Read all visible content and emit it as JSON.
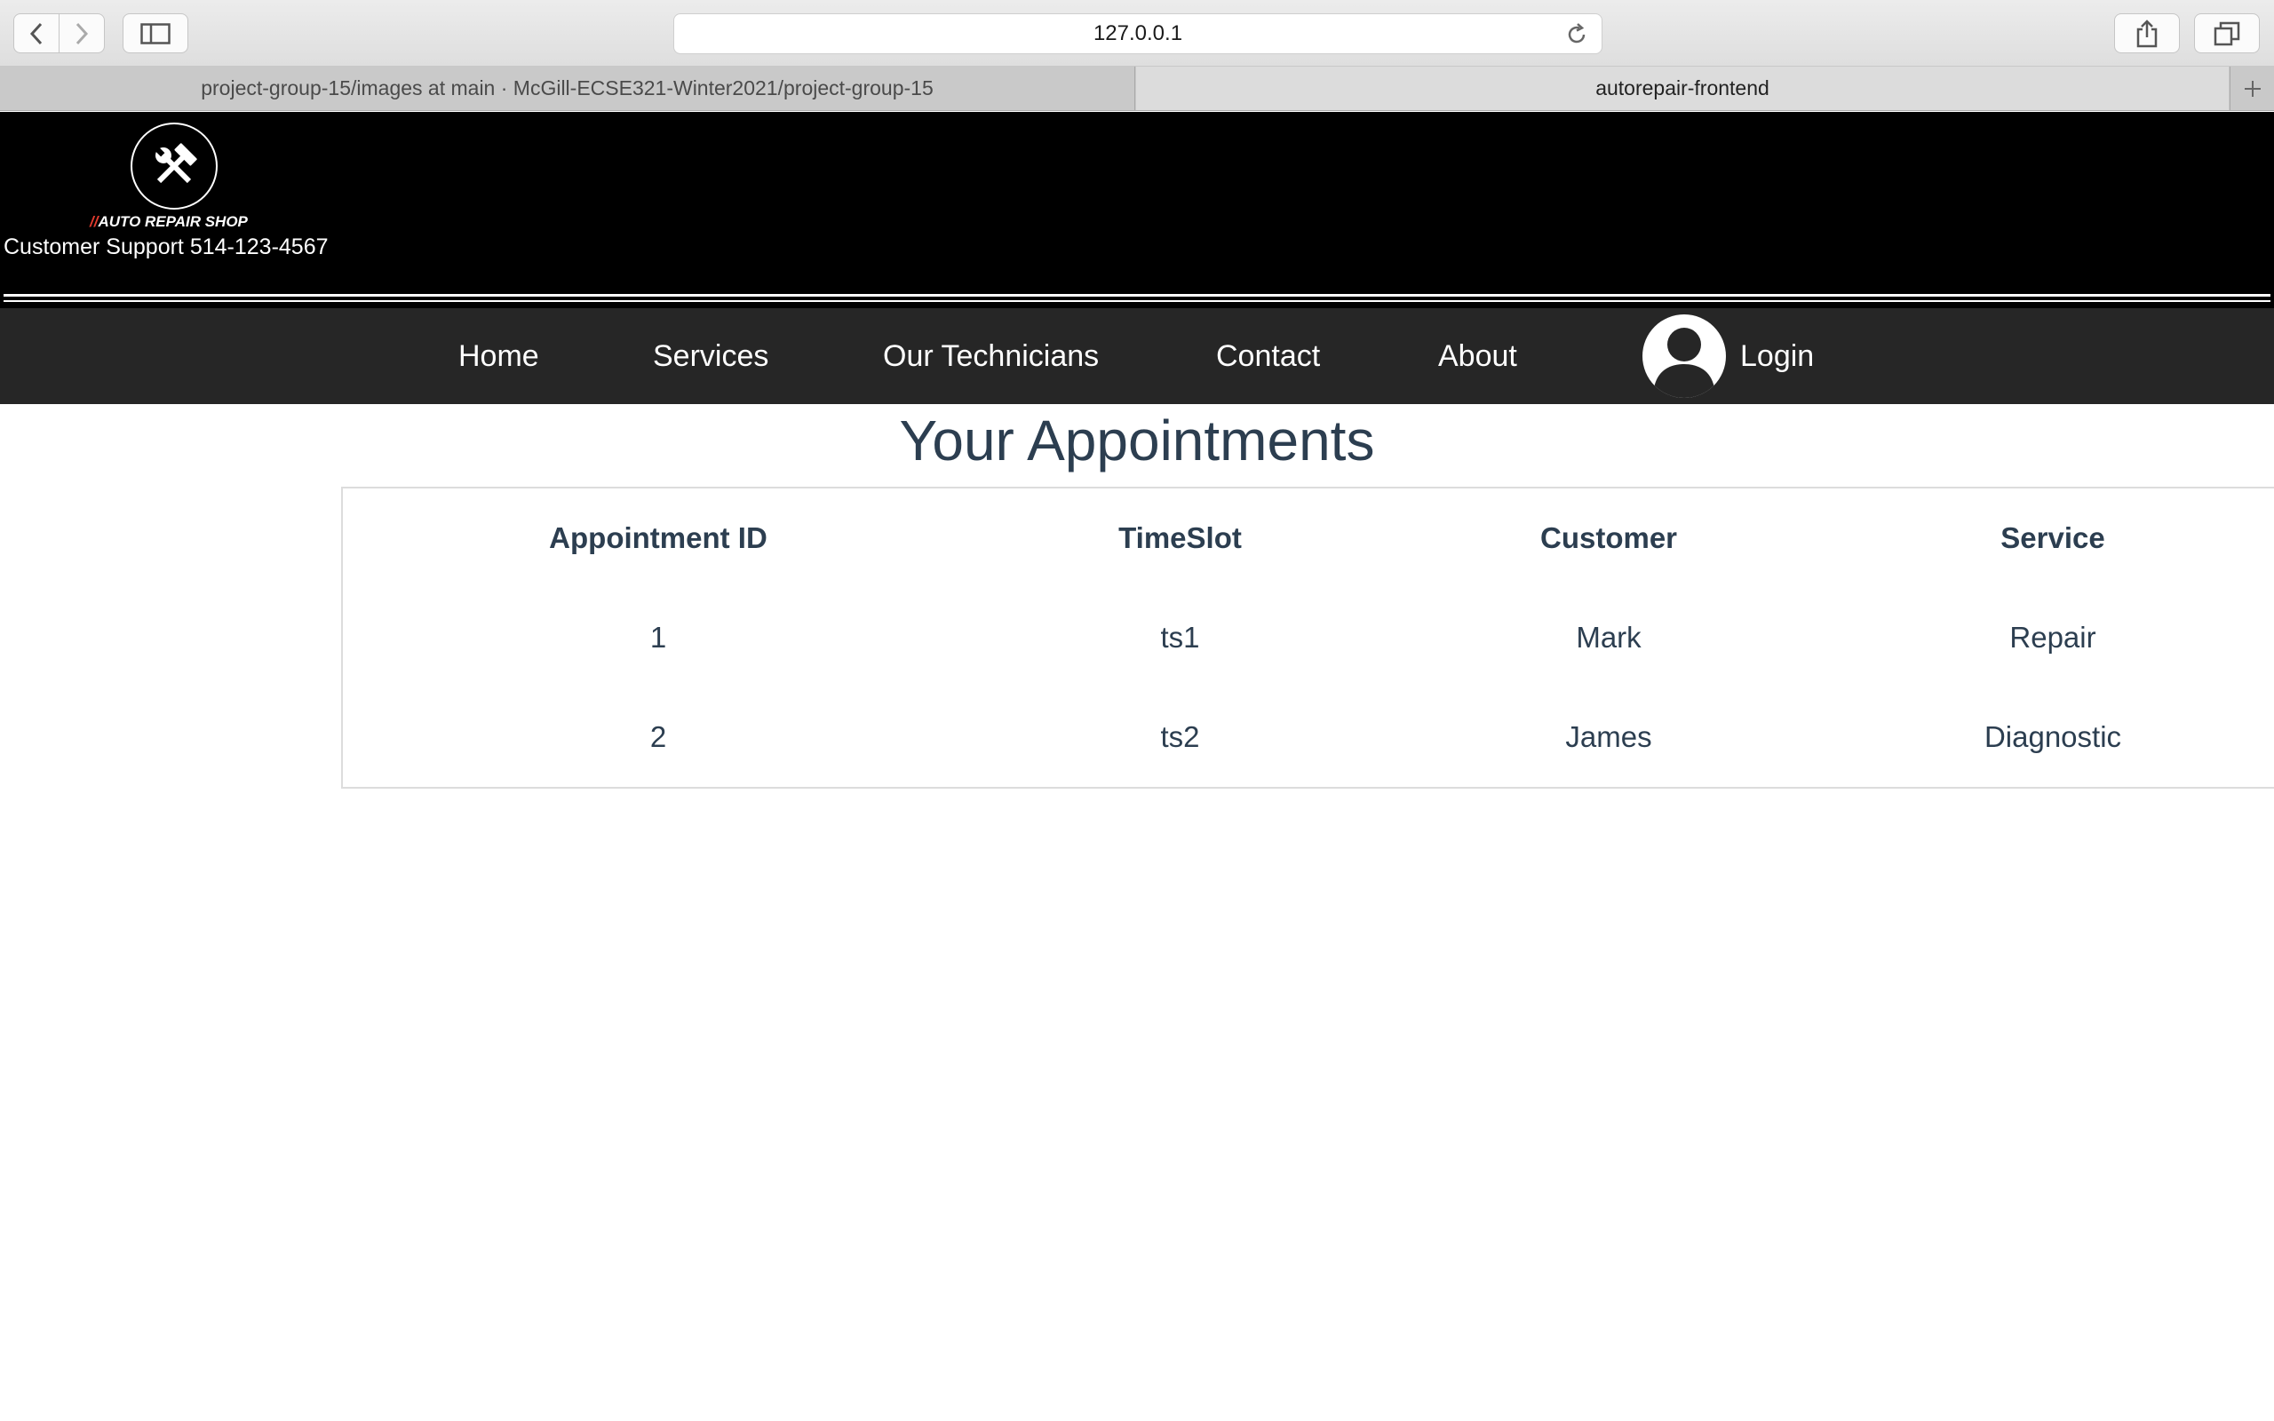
{
  "browser": {
    "address": "127.0.0.1",
    "tabs": [
      {
        "label": "project-group-15/images at main · McGill-ECSE321-Winter2021/project-group-15",
        "active": false
      },
      {
        "label": "autorepair-frontend",
        "active": true
      }
    ],
    "icons": [
      "back-icon",
      "forward-icon",
      "sidebar-icon",
      "reload-icon",
      "share-icon",
      "tabs-overview-icon",
      "plus-icon"
    ]
  },
  "header": {
    "logo_slash": "//",
    "logo_text": "AUTO REPAIR SHOP",
    "support": "Customer Support 514-123-4567",
    "logo_icon": "hammer-wrench-icon"
  },
  "nav": {
    "home": "Home",
    "services": "Services",
    "technicians": "Our Technicians",
    "contact": "Contact",
    "about": "About",
    "login": "Login",
    "login_icon": "user-avatar-icon"
  },
  "main": {
    "title": "Your Appointments",
    "table": {
      "headers": [
        "Appointment ID",
        "TimeSlot",
        "Customer",
        "Service"
      ],
      "rows": [
        [
          "1",
          "ts1",
          "Mark",
          "Repair"
        ],
        [
          "2",
          "ts2",
          "James",
          "Diagnostic"
        ]
      ]
    }
  },
  "colors": {
    "header_bg": "#000000",
    "nav_bg": "#262626",
    "text_dark": "#2c3e50",
    "logo_accent": "#e23b2e"
  }
}
